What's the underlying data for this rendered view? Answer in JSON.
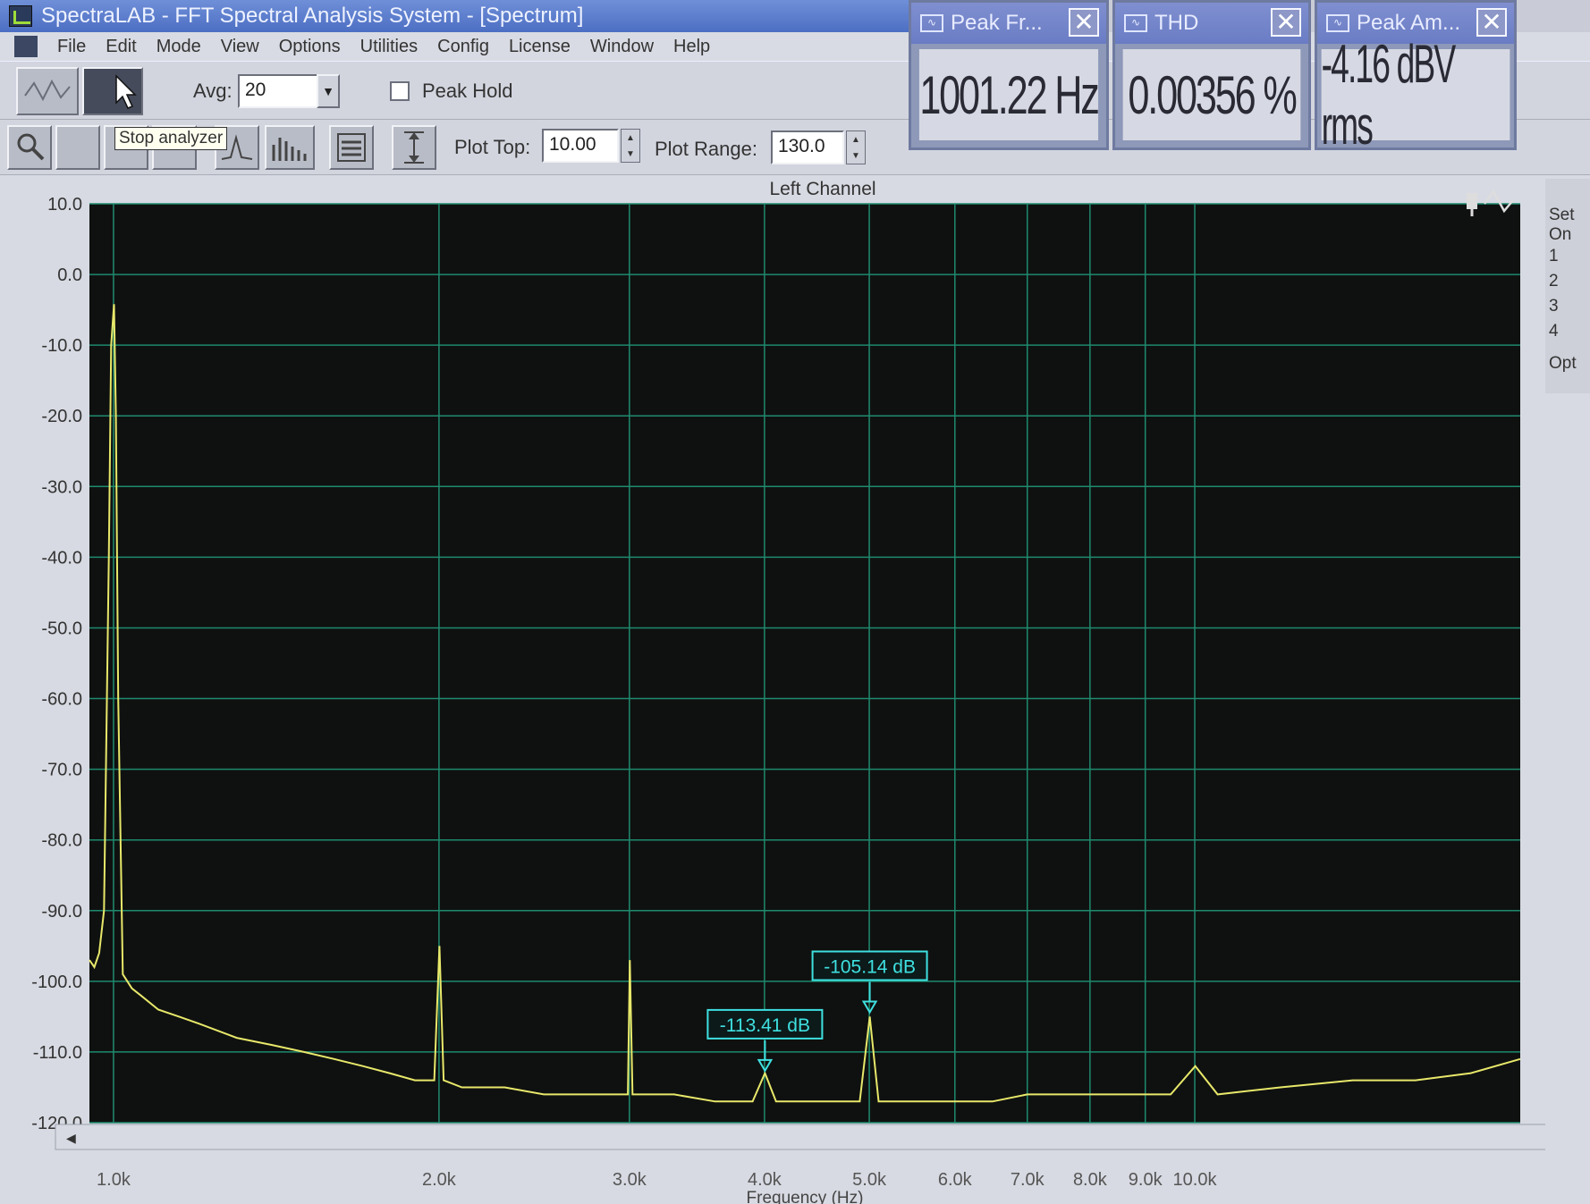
{
  "window": {
    "title": "SpectraLAB - FFT Spectral Analysis System - [Spectrum]"
  },
  "menu": [
    "File",
    "Edit",
    "Mode",
    "View",
    "Options",
    "Utilities",
    "Config",
    "License",
    "Window",
    "Help"
  ],
  "toolbar": {
    "avg_label": "Avg:",
    "avg_value": "20",
    "peak_hold_label": "Peak Hold",
    "peak_hold_checked": false,
    "tooltip": "Stop analyzer",
    "plot_top_label": "Plot Top:",
    "plot_top_value": "10.00",
    "plot_range_label": "Plot Range:",
    "plot_range_value": "130.0"
  },
  "meters": [
    {
      "title": "Peak Fr...",
      "value": "1001.22 Hz"
    },
    {
      "title": "THD",
      "value": "0.00356 %"
    },
    {
      "title": "Peak Am...",
      "value": "-4.16 dBV rms"
    }
  ],
  "side_panel": {
    "set_label": "Set",
    "on_label": "On",
    "items": [
      "1",
      "2",
      "3",
      "4"
    ],
    "opt_label": "Opt"
  },
  "colors": {
    "plot_bg": "#0f1110",
    "grid": "#1f8a6e",
    "trace": "#e8e86a",
    "marker": "#3fe0e0"
  },
  "chart_data": {
    "type": "line",
    "title": "Left Channel",
    "xlabel": "Frequency (Hz)",
    "ylabel": "",
    "x_scale": "log",
    "xlim": [
      950,
      20000
    ],
    "ylim": [
      -120,
      10
    ],
    "y_ticks": [
      "10.0",
      "0.0",
      "-10.0",
      "-20.0",
      "-30.0",
      "-40.0",
      "-50.0",
      "-60.0",
      "-70.0",
      "-80.0",
      "-90.0",
      "-100.0",
      "-110.0",
      "-120.0"
    ],
    "y_tick_values": [
      10,
      0,
      -10,
      -20,
      -30,
      -40,
      -50,
      -60,
      -70,
      -80,
      -90,
      -100,
      -110,
      -120
    ],
    "x_ticks": [
      "1.0k",
      "2.0k",
      "3.0k",
      "4.0k",
      "5.0k",
      "6.0k",
      "7.0k",
      "8.0k",
      "9.0k",
      "10.0k"
    ],
    "x_tick_values": [
      1000,
      2000,
      3000,
      4000,
      5000,
      6000,
      7000,
      8000,
      9000,
      10000
    ],
    "series": [
      {
        "x": [
          950,
          960,
          970,
          980,
          990,
          995,
          1001,
          1005,
          1010,
          1020,
          1040,
          1060,
          1100,
          1150,
          1200,
          1300,
          1400,
          1500,
          1600,
          1700,
          1800,
          1900,
          1980,
          2002,
          2020,
          2100,
          2300,
          2500,
          2800,
          2990,
          3003,
          3020,
          3300,
          3600,
          3900,
          4004,
          4100,
          4500,
          4900,
          5005,
          5100,
          5500,
          6000,
          6500,
          7000,
          7500,
          8000,
          8500,
          9000,
          9500,
          10010,
          10500,
          12000,
          14000,
          16000,
          18000,
          20000
        ],
        "y": [
          -97,
          -98,
          -96,
          -90,
          -40,
          -10,
          -4.2,
          -20,
          -60,
          -99,
          -101,
          -102,
          -104,
          -105,
          -106,
          -108,
          -109,
          -110,
          -111,
          -112,
          -113,
          -114,
          -114,
          -95,
          -114,
          -115,
          -115,
          -116,
          -116,
          -116,
          -97,
          -116,
          -116,
          -117,
          -117,
          -113,
          -117,
          -117,
          -117,
          -105,
          -117,
          -117,
          -117,
          -117,
          -116,
          -116,
          -116,
          -116,
          -116,
          -116,
          -112,
          -116,
          -115,
          -114,
          -114,
          -113,
          -111
        ]
      }
    ],
    "markers": [
      {
        "x": 4004,
        "y": -113.41,
        "label": "-113.41 dB"
      },
      {
        "x": 5005,
        "y": -105.14,
        "label": "-105.14 dB"
      }
    ]
  }
}
